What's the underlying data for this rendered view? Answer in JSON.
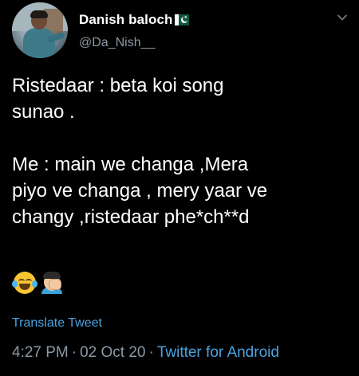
{
  "author": {
    "display_name": "Danish baloch",
    "handle": "@Da_Nish__",
    "flag_icon": "pakistan-flag-icon"
  },
  "tweet": {
    "text": "Ristedaar : beta koi song\nsunao .\n\nMe : main we changa ,Mera\npiyo ve changa , mery yaar ve\nchangy ,ristedaar phe*ch**d",
    "emojis": [
      "face-with-tears-of-joy-icon",
      "person-facepalming-icon"
    ],
    "translate_label": "Translate Tweet",
    "time": "4:27 PM",
    "separator": "·",
    "date": "02 Oct 20",
    "source": "Twitter for Android"
  },
  "colors": {
    "background": "#000000",
    "primary_text": "#ffffff",
    "secondary_text": "#8b98a5",
    "link": "#4aa3df"
  }
}
